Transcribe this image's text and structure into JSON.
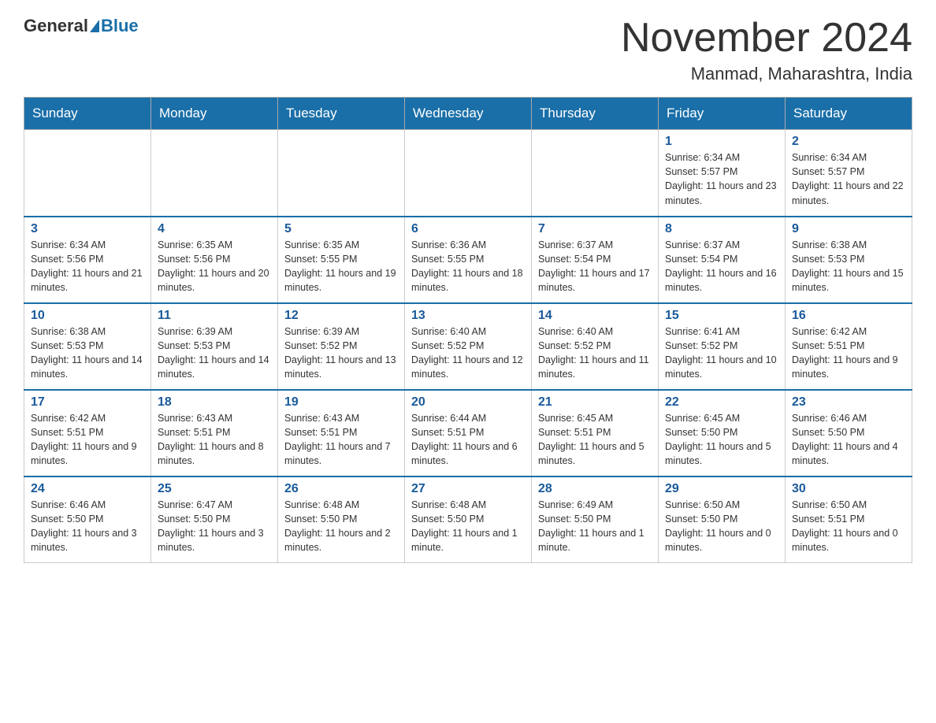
{
  "header": {
    "logo_general": "General",
    "logo_blue": "Blue",
    "month_title": "November 2024",
    "location": "Manmad, Maharashtra, India"
  },
  "days_of_week": [
    "Sunday",
    "Monday",
    "Tuesday",
    "Wednesday",
    "Thursday",
    "Friday",
    "Saturday"
  ],
  "weeks": [
    [
      {
        "day": "",
        "info": ""
      },
      {
        "day": "",
        "info": ""
      },
      {
        "day": "",
        "info": ""
      },
      {
        "day": "",
        "info": ""
      },
      {
        "day": "",
        "info": ""
      },
      {
        "day": "1",
        "info": "Sunrise: 6:34 AM\nSunset: 5:57 PM\nDaylight: 11 hours and 23 minutes."
      },
      {
        "day": "2",
        "info": "Sunrise: 6:34 AM\nSunset: 5:57 PM\nDaylight: 11 hours and 22 minutes."
      }
    ],
    [
      {
        "day": "3",
        "info": "Sunrise: 6:34 AM\nSunset: 5:56 PM\nDaylight: 11 hours and 21 minutes."
      },
      {
        "day": "4",
        "info": "Sunrise: 6:35 AM\nSunset: 5:56 PM\nDaylight: 11 hours and 20 minutes."
      },
      {
        "day": "5",
        "info": "Sunrise: 6:35 AM\nSunset: 5:55 PM\nDaylight: 11 hours and 19 minutes."
      },
      {
        "day": "6",
        "info": "Sunrise: 6:36 AM\nSunset: 5:55 PM\nDaylight: 11 hours and 18 minutes."
      },
      {
        "day": "7",
        "info": "Sunrise: 6:37 AM\nSunset: 5:54 PM\nDaylight: 11 hours and 17 minutes."
      },
      {
        "day": "8",
        "info": "Sunrise: 6:37 AM\nSunset: 5:54 PM\nDaylight: 11 hours and 16 minutes."
      },
      {
        "day": "9",
        "info": "Sunrise: 6:38 AM\nSunset: 5:53 PM\nDaylight: 11 hours and 15 minutes."
      }
    ],
    [
      {
        "day": "10",
        "info": "Sunrise: 6:38 AM\nSunset: 5:53 PM\nDaylight: 11 hours and 14 minutes."
      },
      {
        "day": "11",
        "info": "Sunrise: 6:39 AM\nSunset: 5:53 PM\nDaylight: 11 hours and 14 minutes."
      },
      {
        "day": "12",
        "info": "Sunrise: 6:39 AM\nSunset: 5:52 PM\nDaylight: 11 hours and 13 minutes."
      },
      {
        "day": "13",
        "info": "Sunrise: 6:40 AM\nSunset: 5:52 PM\nDaylight: 11 hours and 12 minutes."
      },
      {
        "day": "14",
        "info": "Sunrise: 6:40 AM\nSunset: 5:52 PM\nDaylight: 11 hours and 11 minutes."
      },
      {
        "day": "15",
        "info": "Sunrise: 6:41 AM\nSunset: 5:52 PM\nDaylight: 11 hours and 10 minutes."
      },
      {
        "day": "16",
        "info": "Sunrise: 6:42 AM\nSunset: 5:51 PM\nDaylight: 11 hours and 9 minutes."
      }
    ],
    [
      {
        "day": "17",
        "info": "Sunrise: 6:42 AM\nSunset: 5:51 PM\nDaylight: 11 hours and 9 minutes."
      },
      {
        "day": "18",
        "info": "Sunrise: 6:43 AM\nSunset: 5:51 PM\nDaylight: 11 hours and 8 minutes."
      },
      {
        "day": "19",
        "info": "Sunrise: 6:43 AM\nSunset: 5:51 PM\nDaylight: 11 hours and 7 minutes."
      },
      {
        "day": "20",
        "info": "Sunrise: 6:44 AM\nSunset: 5:51 PM\nDaylight: 11 hours and 6 minutes."
      },
      {
        "day": "21",
        "info": "Sunrise: 6:45 AM\nSunset: 5:51 PM\nDaylight: 11 hours and 5 minutes."
      },
      {
        "day": "22",
        "info": "Sunrise: 6:45 AM\nSunset: 5:50 PM\nDaylight: 11 hours and 5 minutes."
      },
      {
        "day": "23",
        "info": "Sunrise: 6:46 AM\nSunset: 5:50 PM\nDaylight: 11 hours and 4 minutes."
      }
    ],
    [
      {
        "day": "24",
        "info": "Sunrise: 6:46 AM\nSunset: 5:50 PM\nDaylight: 11 hours and 3 minutes."
      },
      {
        "day": "25",
        "info": "Sunrise: 6:47 AM\nSunset: 5:50 PM\nDaylight: 11 hours and 3 minutes."
      },
      {
        "day": "26",
        "info": "Sunrise: 6:48 AM\nSunset: 5:50 PM\nDaylight: 11 hours and 2 minutes."
      },
      {
        "day": "27",
        "info": "Sunrise: 6:48 AM\nSunset: 5:50 PM\nDaylight: 11 hours and 1 minute."
      },
      {
        "day": "28",
        "info": "Sunrise: 6:49 AM\nSunset: 5:50 PM\nDaylight: 11 hours and 1 minute."
      },
      {
        "day": "29",
        "info": "Sunrise: 6:50 AM\nSunset: 5:50 PM\nDaylight: 11 hours and 0 minutes."
      },
      {
        "day": "30",
        "info": "Sunrise: 6:50 AM\nSunset: 5:51 PM\nDaylight: 11 hours and 0 minutes."
      }
    ]
  ]
}
